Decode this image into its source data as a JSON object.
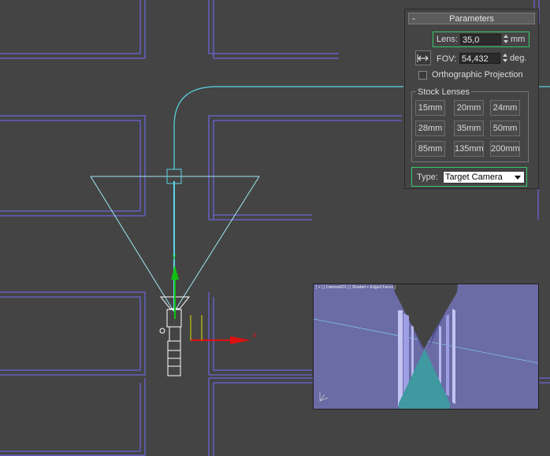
{
  "parameters": {
    "title": "Parameters",
    "collapse_symbol": "-",
    "lens_label": "Lens:",
    "lens_value": "35,0",
    "lens_unit": "mm",
    "fov_label": "FOV:",
    "fov_value": "54,432",
    "fov_unit": "deg.",
    "fov_direction_icon": "horizontal-arrows-icon",
    "orthographic_label": "Orthographic Projection",
    "orthographic_checked": false,
    "stock_lenses_title": "Stock Lenses",
    "stock_lenses": [
      "15mm",
      "20mm",
      "24mm",
      "28mm",
      "35mm",
      "50mm",
      "85mm",
      "135mm",
      "200mm"
    ],
    "type_label": "Type:",
    "type_value": "Target Camera"
  },
  "preview": {
    "label": "[ + ] [ Camera001 ] [ Shaded + Edged Faces ]"
  },
  "colors": {
    "viewport_bg": "#444444",
    "wall_lines": "#6a64d6",
    "camera_lines": "#5ad6e6",
    "highlight_border": "#37c96a",
    "preview_bg": "#6b6ba6",
    "axis_x": "#e01010",
    "axis_y": "#10c010",
    "axis_other": "#e0e000"
  }
}
